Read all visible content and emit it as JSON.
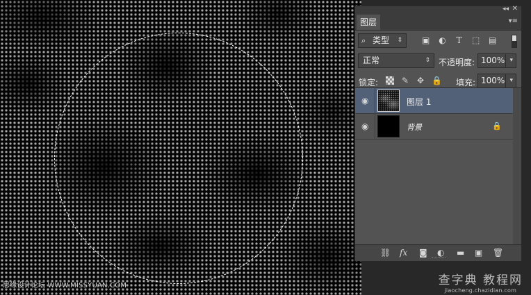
{
  "canvas": {
    "watermark_left": "思缘设计论坛 WWW.MISSYUAN.COM",
    "watermark_right_big": "查字典 教程网",
    "watermark_right_small": "jiaocheng.chazidian.com"
  },
  "panel": {
    "collapse_glyph": "◂◂",
    "close_glyph": "✕",
    "tab_label": "图层",
    "menu_glyph": "▾≡",
    "filter": {
      "search_glyph": "⌕",
      "kind_label": "类型",
      "arrow_glyph": "⇕",
      "icons": [
        "image-filter-icon",
        "adjustment-filter-icon",
        "type-filter-icon",
        "shape-filter-icon",
        "smart-object-filter-icon"
      ]
    },
    "blend": {
      "mode": "正常",
      "arrow_glyph": "⇕",
      "opacity_label": "不透明度:",
      "opacity_value": "100%",
      "dropdown_glyph": "▾"
    },
    "lock": {
      "label": "锁定:",
      "fill_label": "填充:",
      "fill_value": "100%",
      "dropdown_glyph": "▾"
    },
    "layers": [
      {
        "name": "图层 1",
        "visible": true,
        "selected": true,
        "locked": false,
        "eye_glyph": "◉"
      },
      {
        "name": "背景",
        "visible": true,
        "selected": false,
        "locked": true,
        "eye_glyph": "◉",
        "lock_glyph": "🔒"
      }
    ],
    "bottom_icons": {
      "link": "⛓",
      "fx": "fx",
      "mask": "◙",
      "adjustment": "◐",
      "group": "▬",
      "new_layer": "▣",
      "delete": "🗑"
    }
  }
}
